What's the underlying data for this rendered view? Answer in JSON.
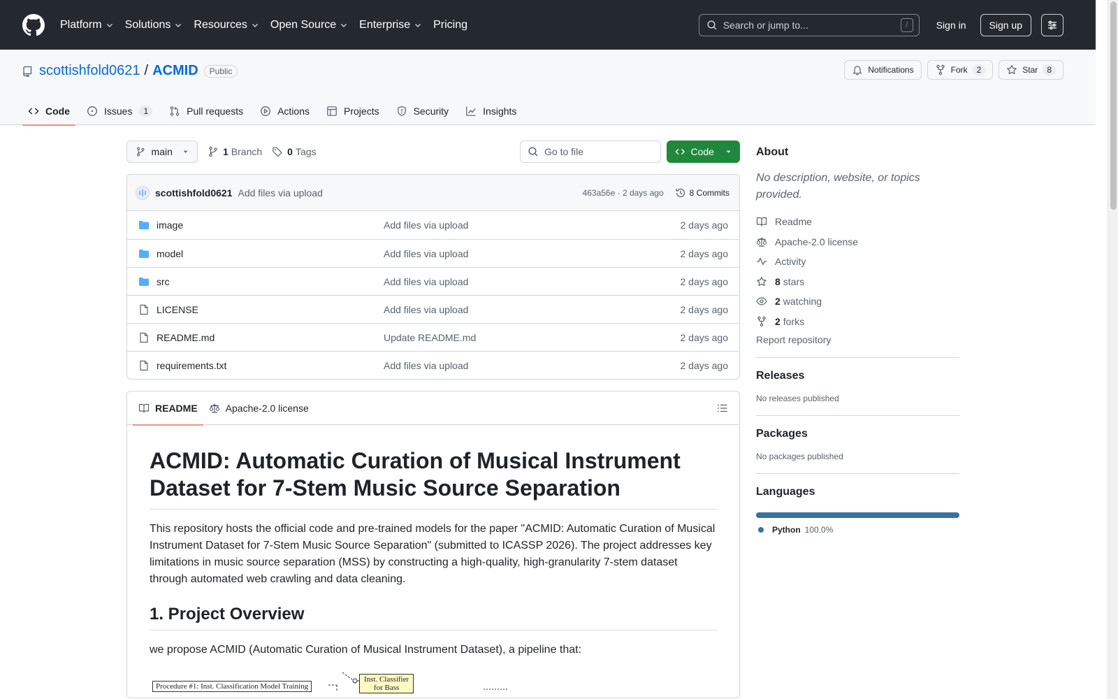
{
  "header": {
    "nav": [
      "Platform",
      "Solutions",
      "Resources",
      "Open Source",
      "Enterprise",
      "Pricing"
    ],
    "search_placeholder": "Search or jump to...",
    "search_shortcut": "/",
    "sign_in": "Sign in",
    "sign_up": "Sign up"
  },
  "repo": {
    "owner": "scottishfold0621",
    "separator": "/",
    "name": "ACMID",
    "visibility": "Public",
    "notifications_label": "Notifications",
    "fork_label": "Fork",
    "fork_count": "2",
    "star_label": "Star",
    "star_count": "8",
    "tabs": {
      "code": "Code",
      "issues": "Issues",
      "issues_count": "1",
      "pulls": "Pull requests",
      "actions": "Actions",
      "projects": "Projects",
      "security": "Security",
      "insights": "Insights"
    }
  },
  "filenav": {
    "branch": "main",
    "branch_count": "1",
    "branch_label": "Branch",
    "tag_count": "0",
    "tag_label": "Tags",
    "goto_placeholder": "Go to file",
    "code_button": "Code"
  },
  "commit": {
    "author": "scottishfold0621",
    "message": "Add files via upload",
    "hash_time": "463a56e · 2 days ago",
    "count_label": "8 Commits"
  },
  "files": [
    {
      "name": "image",
      "type": "folder",
      "commit": "Add files via upload",
      "date": "2 days ago"
    },
    {
      "name": "model",
      "type": "folder",
      "commit": "Add files via upload",
      "date": "2 days ago"
    },
    {
      "name": "src",
      "type": "folder",
      "commit": "Add files via upload",
      "date": "2 days ago"
    },
    {
      "name": "LICENSE",
      "type": "file",
      "commit": "Add files via upload",
      "date": "2 days ago"
    },
    {
      "name": "README.md",
      "type": "file",
      "commit": "Update README.md",
      "date": "2 days ago"
    },
    {
      "name": "requirements.txt",
      "type": "file",
      "commit": "Add files via upload",
      "date": "2 days ago"
    }
  ],
  "readme": {
    "tab_readme": "README",
    "tab_license": "Apache-2.0 license",
    "h1": "ACMID: Automatic Curation of Musical Instrument Dataset for 7-Stem Music Source Separation",
    "intro": "This repository hosts the official code and pre-trained models for the paper \"ACMID: Automatic Curation of Musical Instrument Dataset for 7-Stem Music Source Separation\" (submitted to ICASSP 2026). The project addresses key limitations in music source separation (MSS) by constructing a high-quality, high-granularity 7-stem dataset through automated web crawling and data cleaning.",
    "h2": "1. Project Overview",
    "overview": "we propose ACMID (Automatic Curation of Musical Instrument Dataset), a pipeline that:",
    "diagram_proc": "Procedure #1: Inst. Classification Model Training",
    "diagram_inst_line1": "Inst. Classifier",
    "diagram_inst_line2": "for Bass"
  },
  "sidebar": {
    "about_title": "About",
    "about_desc": "No description, website, or topics provided.",
    "readme": "Readme",
    "license": "Apache-2.0 license",
    "activity": "Activity",
    "stars_count": "8",
    "stars_label": "stars",
    "watching_count": "2",
    "watching_label": "watching",
    "forks_count": "2",
    "forks_label": "forks",
    "report": "Report repository",
    "releases_title": "Releases",
    "releases_empty": "No releases published",
    "packages_title": "Packages",
    "packages_empty": "No packages published",
    "languages_title": "Languages",
    "language_name": "Python",
    "language_pct": "100.0%",
    "language_color": "#3572A5"
  }
}
